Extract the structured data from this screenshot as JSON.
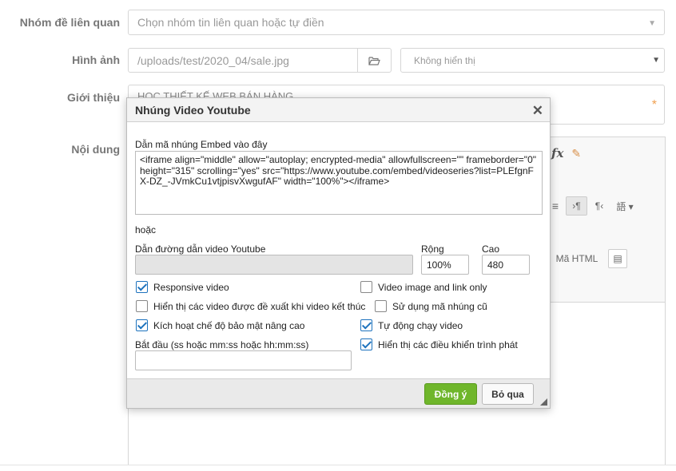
{
  "form": {
    "group_label": "Nhóm đề liên quan",
    "group_placeholder": "Chọn nhóm tin liên quan hoặc tự điền",
    "image_label": "Hình ảnh",
    "image_path": "/uploads/test/2020_04/sale.jpg",
    "image_display_select": "Không hiển thị",
    "intro_label": "Giới thiệu",
    "intro_value": "HỌC THIẾT KẾ WEB BÁN HÀNG",
    "required_mark": "*",
    "content_label": "Nội dung"
  },
  "editor": {
    "formula_icon_text": "fx",
    "html_button_label": "Mã HTML",
    "paragraph_ltr": "›¶",
    "paragraph_rtl": "¶‹",
    "language_dropdown": "語 ▾"
  },
  "dialog": {
    "title": "Nhúng Video Youtube",
    "embed_label": "Dẫn mã nhúng Embed vào đây",
    "embed_code": "<iframe align=\"middle\" allow=\"autoplay; encrypted-media\" allowfullscreen=\"\" frameborder=\"0\" height=\"315\" scrolling=\"yes\" src=\"https://www.youtube.com/embed/videoseries?list=PLEfgnFX-DZ_-JVmkCu1vtjpisvXwgufAF\" width=\"100%\"></iframe>",
    "or_text": "hoặc",
    "url_label": "Dẫn đường dẫn video Youtube",
    "url_value": "",
    "width_label": "Rộng",
    "width_value": "100%",
    "height_label": "Cao",
    "height_value": "480",
    "options": {
      "responsive": {
        "label": "Responsive video",
        "checked": true
      },
      "image_link_only": {
        "label": "Video image and link only",
        "checked": false
      },
      "show_suggested": {
        "label": "Hiển thị các video được đề xuất khi video kết thúc",
        "checked": false
      },
      "old_embed": {
        "label": "Sử dụng mã nhúng cũ",
        "checked": false
      },
      "privacy_mode": {
        "label": "Kích hoạt chế độ bảo mật nâng cao",
        "checked": true
      },
      "autoplay": {
        "label": "Tự động chạy video",
        "checked": true
      },
      "show_controls": {
        "label": "Hiển thị các điều khiển trình phát",
        "checked": true
      }
    },
    "start_label": "Bắt đầu (ss hoặc mm:ss hoặc hh:mm:ss)",
    "start_value": "",
    "ok_label": "Đồng ý",
    "cancel_label": "Bỏ qua"
  },
  "colors": {
    "ok_button": "#6fb62b",
    "checkbox_accent": "#1e73be"
  }
}
